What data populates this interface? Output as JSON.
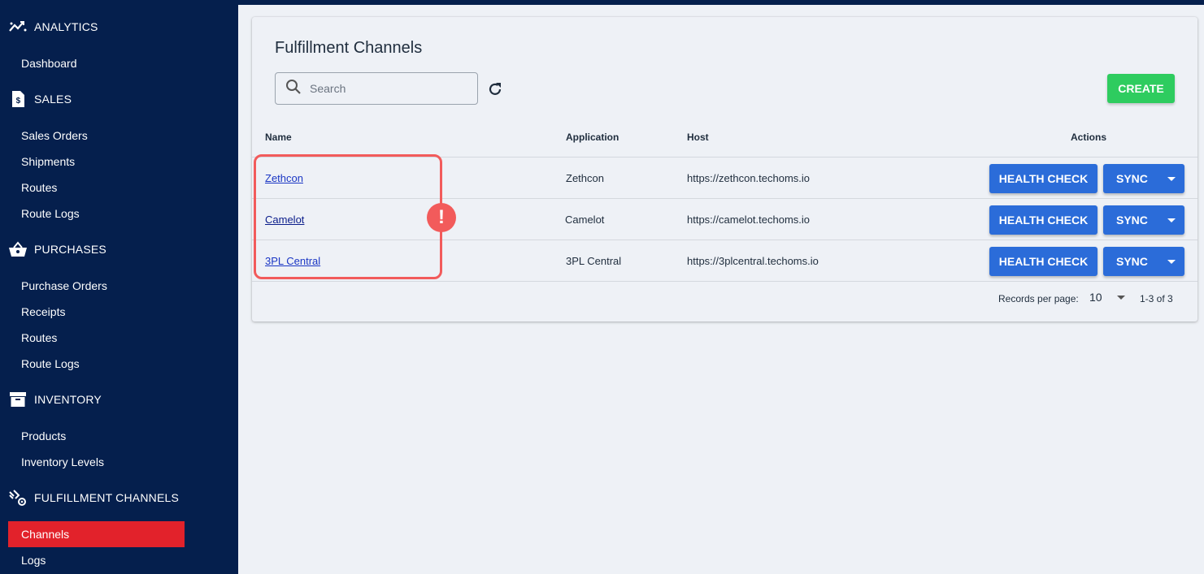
{
  "colors": {
    "sidebar_bg": "#051f4d",
    "active_item": "#e2222b",
    "create_button": "#2ecc5f",
    "action_button": "#2b6cd9",
    "highlight": "#f25b5b"
  },
  "sidebar": {
    "sections": [
      {
        "label": "ANALYTICS",
        "icon": "analytics-icon",
        "items": [
          "Dashboard"
        ]
      },
      {
        "label": "SALES",
        "icon": "dollar-file-icon",
        "items": [
          "Sales Orders",
          "Shipments",
          "Routes",
          "Route Logs"
        ]
      },
      {
        "label": "PURCHASES",
        "icon": "basket-icon",
        "items": [
          "Purchase Orders",
          "Receipts",
          "Routes",
          "Route Logs"
        ]
      },
      {
        "label": "INVENTORY",
        "icon": "archive-box-icon",
        "items": [
          "Products",
          "Inventory Levels"
        ]
      },
      {
        "label": "FULFILLMENT CHANNELS",
        "icon": "fulfillment-icon",
        "items": [
          "Channels",
          "Logs"
        ]
      }
    ],
    "active_item": "Channels"
  },
  "page": {
    "title": "Fulfillment Channels",
    "search": {
      "placeholder": "Search",
      "value": ""
    },
    "create_label": "CREATE"
  },
  "table": {
    "columns": [
      "Name",
      "Application",
      "Host",
      "Actions"
    ],
    "rows": [
      {
        "name": "Zethcon",
        "application": "Zethcon",
        "host": "https://zethcon.techoms.io",
        "health_label": "HEALTH CHECK",
        "sync_label": "SYNC"
      },
      {
        "name": "Camelot",
        "application": "Camelot",
        "host": "https://camelot.techoms.io",
        "health_label": "HEALTH CHECK",
        "sync_label": "SYNC"
      },
      {
        "name": "3PL Central",
        "application": "3PL Central",
        "host": "https://3plcentral.techoms.io",
        "health_label": "HEALTH CHECK",
        "sync_label": "SYNC"
      }
    ]
  },
  "pagination": {
    "records_label": "Records per page:",
    "per_page": "10",
    "range": "1-3 of 3"
  },
  "annotation": {
    "icon": "exclamation-icon",
    "symbol": "!"
  }
}
